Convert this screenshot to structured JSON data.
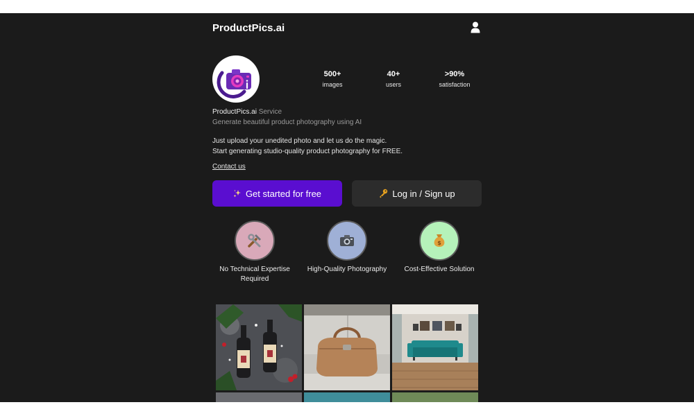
{
  "header": {
    "brand": "ProductPics.ai",
    "user_icon": "user-icon"
  },
  "profile": {
    "avatar_icon": "camera-logo-icon",
    "stats": [
      {
        "value": "500+",
        "label": "images"
      },
      {
        "value": "40+",
        "label": "users"
      },
      {
        "value": ">90%",
        "label": "satisfaction"
      }
    ],
    "service_name": "ProductPics.ai",
    "service_tag": "Service",
    "tagline": "Generate beautiful product photography using AI",
    "description_line1": "Just upload your unedited photo and let us do the magic.",
    "description_line2": "Start generating studio-quality product photography for FREE.",
    "contact_link": "Contact us"
  },
  "actions": {
    "primary_label": "Get started for free",
    "primary_icon": "sparkles-icon",
    "secondary_label": "Log in / Sign up",
    "secondary_icon": "key-icon"
  },
  "features": [
    {
      "label": "No Technical Expertise Required",
      "icon": "tools-icon",
      "color": "#d9a9b9"
    },
    {
      "label": "High-Quality Photography",
      "icon": "camera-icon",
      "color": "#9fb0d6"
    },
    {
      "label": "Cost-Effective Solution",
      "icon": "money-bag-icon",
      "color": "#b5f2ba"
    }
  ],
  "gallery": [
    {
      "name": "gallery-wine-bottles",
      "icon": "wine-bottles-photo"
    },
    {
      "name": "gallery-leather-bag",
      "icon": "leather-bag-photo"
    },
    {
      "name": "gallery-teal-sofa",
      "icon": "sofa-room-photo"
    }
  ],
  "colors": {
    "background": "#1b1b1b",
    "accent": "#5a0ed0",
    "secondary_button": "#2c2c2c"
  }
}
